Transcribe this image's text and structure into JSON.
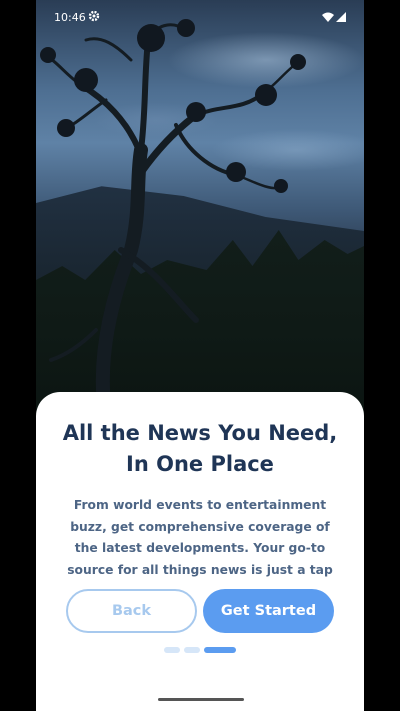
{
  "status_bar": {
    "time": "10:46",
    "icons": [
      "gear-icon",
      "wifi-icon",
      "signal-icon"
    ]
  },
  "onboarding": {
    "headline": "All the News You Need, In One Place",
    "description": "From world events to entertainment buzz, get comprehensive coverage of the latest developments. Your go-to source for all things news is just a tap",
    "back_label": "Back",
    "start_label": "Get Started",
    "page_indicator": {
      "total": 3,
      "current": 3
    }
  },
  "colors": {
    "primary": "#5b9cf0",
    "primary_light": "#a7c9ee",
    "headline": "#1f3556",
    "body_text": "#4d6585",
    "dot_inactive": "#d6e6f8"
  }
}
